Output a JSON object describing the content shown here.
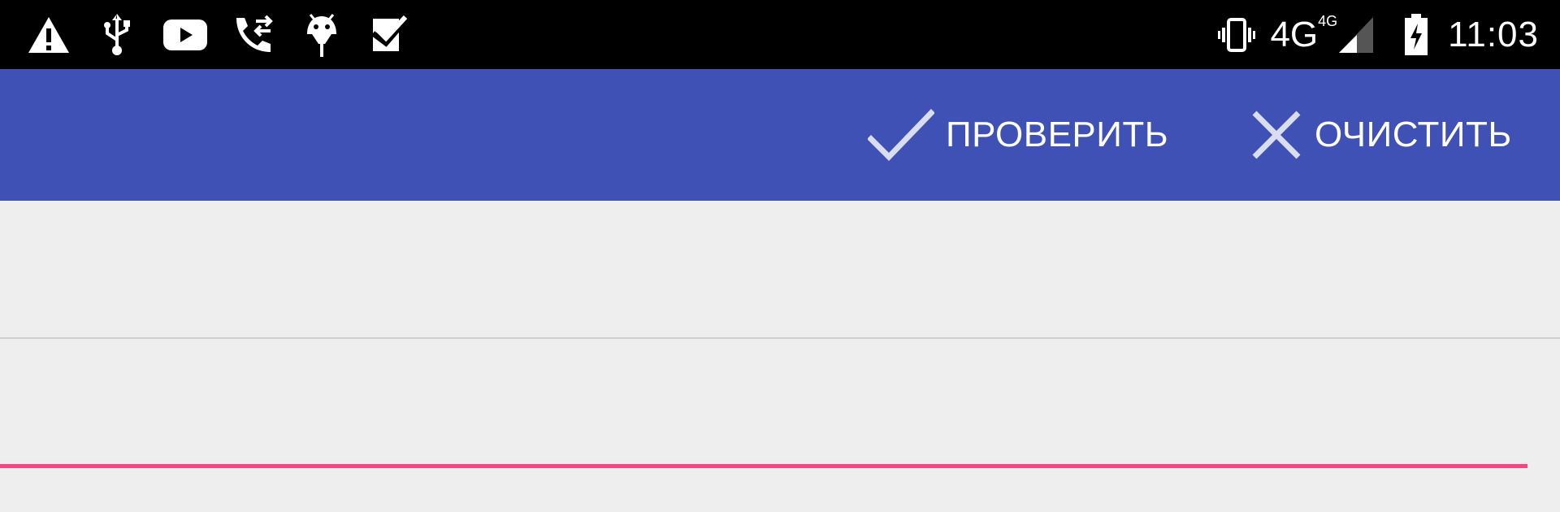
{
  "status_bar": {
    "left_icons": [
      "warning-icon",
      "usb-icon",
      "youtube-icon",
      "call-forward-icon",
      "android-debug-icon",
      "checkbox-notification-icon"
    ],
    "right_icons": [
      "vibrate-icon",
      "signal-icon",
      "battery-charging-icon"
    ],
    "network_type": "4G",
    "network_sup": "4G",
    "time": "11:03"
  },
  "toolbar": {
    "background_color": "#3f51b5",
    "check_label": "ПРОВЕРИТЬ",
    "check_icon": "check-icon",
    "clear_label": "ОЧИСТИТЬ",
    "clear_icon": "close-icon"
  },
  "form": {
    "input_value": "",
    "input_placeholder": "",
    "accent_color": "#ff4081"
  }
}
